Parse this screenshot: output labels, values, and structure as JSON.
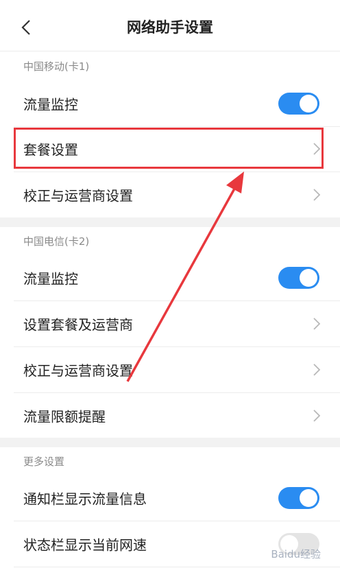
{
  "header": {
    "title": "网络助手设置",
    "back_icon": "chevron-left-icon"
  },
  "sim1": {
    "label": "中国移动(卡1)",
    "items": [
      {
        "label": "流量监控",
        "control": "toggle",
        "on": true
      },
      {
        "label": "套餐设置",
        "control": "chevron"
      },
      {
        "label": "校正与运营商设置",
        "control": "chevron"
      }
    ]
  },
  "sim2": {
    "label": "中国电信(卡2)",
    "items": [
      {
        "label": "流量监控",
        "control": "toggle",
        "on": true
      },
      {
        "label": "设置套餐及运营商",
        "control": "chevron"
      },
      {
        "label": "校正与运营商设置",
        "control": "chevron"
      },
      {
        "label": "流量限额提醒",
        "control": "chevron"
      }
    ]
  },
  "more": {
    "label": "更多设置",
    "items": [
      {
        "label": "通知栏显示流量信息",
        "control": "toggle",
        "on": true
      },
      {
        "label": "状态栏显示当前网速",
        "control": "toggle",
        "on": false
      }
    ]
  },
  "watermark": "Baidu经验",
  "colors": {
    "accent": "#2a8cf1",
    "annotation": "#e8383d"
  }
}
